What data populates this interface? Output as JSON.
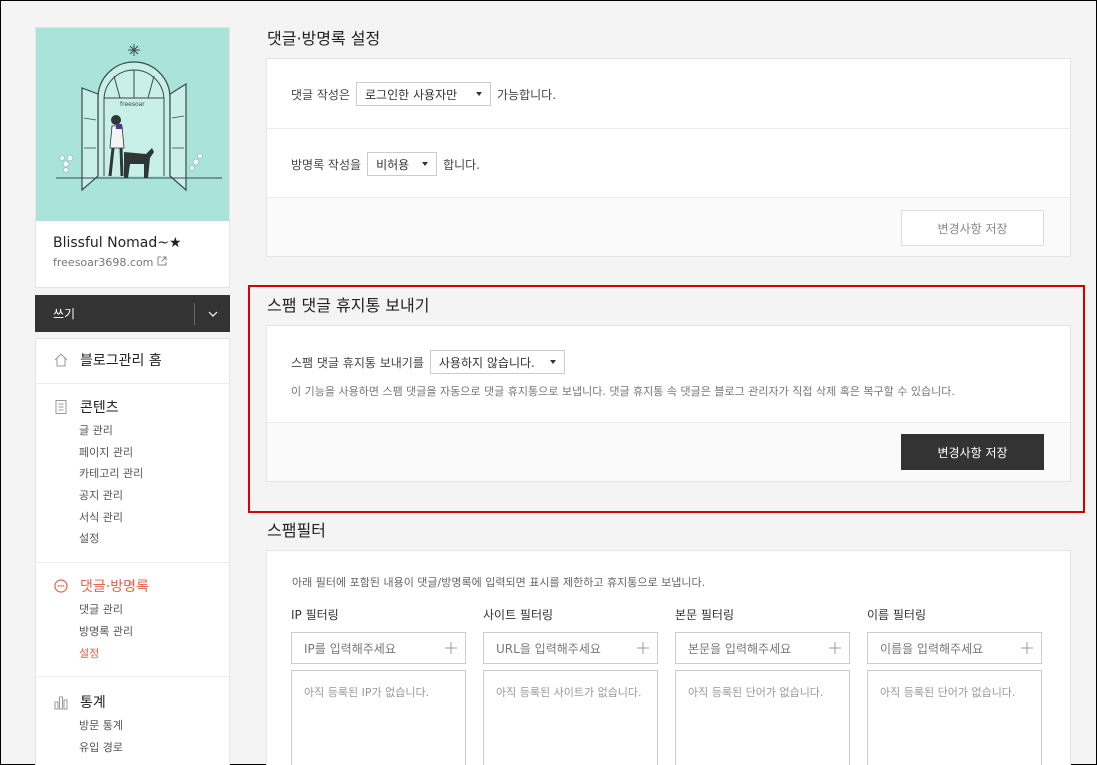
{
  "blog": {
    "title": "Blissful Nomad~★",
    "url": "freesoar3698.com",
    "art_sign": "freesoar"
  },
  "sidebar": {
    "write_label": "쓰기",
    "groups": [
      {
        "label": "블로그관리 홈",
        "icon": "home-icon",
        "items": []
      },
      {
        "label": "콘텐츠",
        "icon": "document-icon",
        "items": [
          "글 관리",
          "페이지 관리",
          "카테고리 관리",
          "공지 관리",
          "서식 관리",
          "설정"
        ]
      },
      {
        "label": "댓글·방명록",
        "icon": "comment-icon",
        "active": true,
        "items": [
          "댓글 관리",
          "방명록 관리",
          "설정"
        ],
        "active_item": "설정"
      },
      {
        "label": "통계",
        "icon": "chart-icon",
        "items": [
          "방문 통계",
          "유입 경로"
        ]
      }
    ]
  },
  "comment_settings": {
    "title": "댓글·방명록 설정",
    "comment_prefix": "댓글 작성은",
    "comment_value": "로그인한 사용자만",
    "comment_suffix": "가능합니다.",
    "guestbook_prefix": "방명록 작성을",
    "guestbook_value": "비허용",
    "guestbook_suffix": "합니다.",
    "save_label": "변경사항 저장"
  },
  "spam_trash": {
    "title": "스팸 댓글 휴지통 보내기",
    "prefix": "스팸 댓글 휴지통 보내기를",
    "value": "사용하지 않습니다.",
    "description": "이 기능을 사용하면 스팸 댓글을 자동으로 댓글 휴지통으로 보냅니다. 댓글 휴지통 속 댓글은 블로그 관리자가 직접 삭제 혹은 복구할 수 있습니다.",
    "save_label": "변경사항 저장",
    "highlight_color": "#d60000"
  },
  "spam_filter": {
    "title": "스팸필터",
    "description": "아래 필터에 포함된 내용이 댓글/방명록에 입력되면 표시를 제한하고 휴지통으로 보냅니다.",
    "filters": [
      {
        "label": "IP 필터링",
        "placeholder": "IP를 입력해주세요",
        "empty": "아직 등록된 IP가 없습니다."
      },
      {
        "label": "사이트 필터링",
        "placeholder": "URL을 입력해주세요",
        "empty": "아직 등록된 사이트가 없습니다."
      },
      {
        "label": "본문 필터링",
        "placeholder": "본문을 입력해주세요",
        "empty": "아직 등록된 단어가 없습니다."
      },
      {
        "label": "이름 필터링",
        "placeholder": "이름을 입력해주세요",
        "empty": "아직 등록된 단어가 없습니다."
      }
    ]
  }
}
